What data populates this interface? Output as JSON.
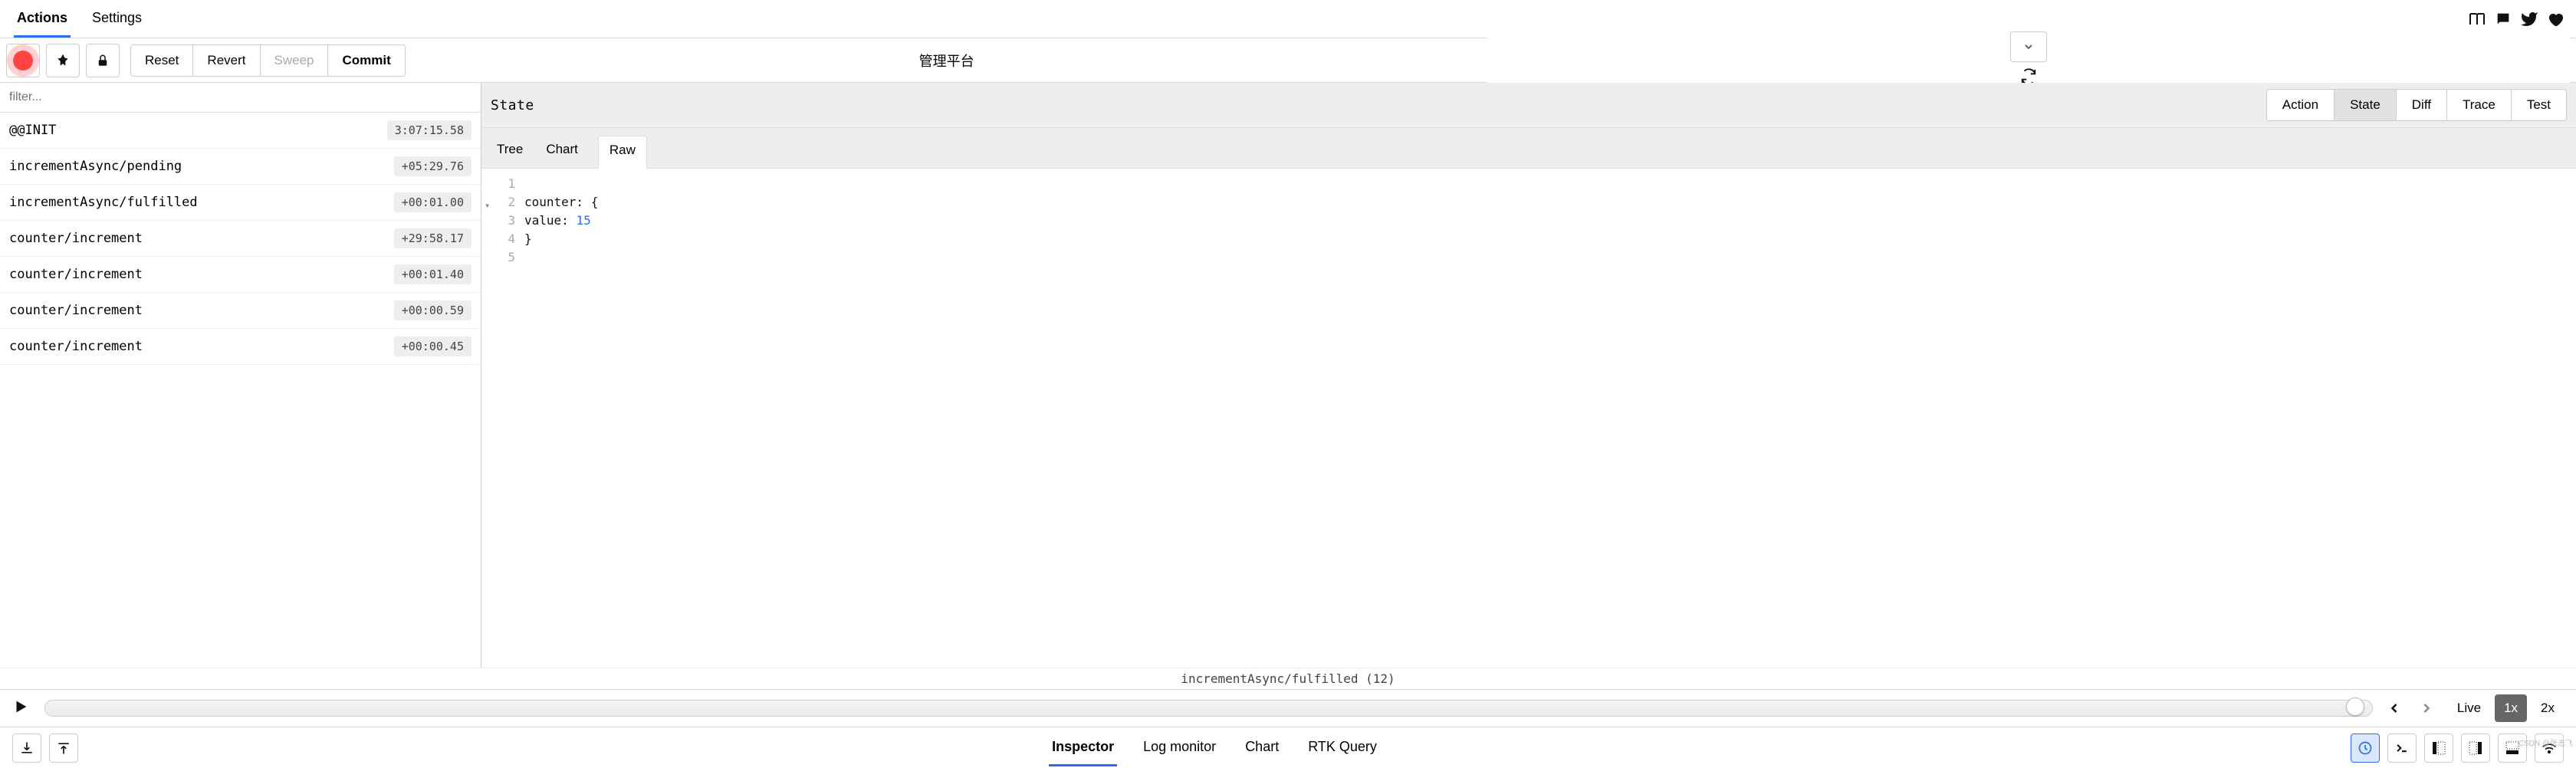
{
  "topbar": {
    "tabs": [
      "Actions",
      "Settings"
    ],
    "active": 0
  },
  "toolbar": {
    "buttons": {
      "reset": "Reset",
      "revert": "Revert",
      "sweep": "Sweep",
      "commit": "Commit"
    },
    "title": "管理平台"
  },
  "filter": {
    "placeholder": "filter..."
  },
  "actions": [
    {
      "name": "@@INIT",
      "time": "3:07:15.58"
    },
    {
      "name": "incrementAsync/pending",
      "time": "+05:29.76"
    },
    {
      "name": "incrementAsync/fulfilled",
      "time": "+00:01.00"
    },
    {
      "name": "counter/increment",
      "time": "+29:58.17"
    },
    {
      "name": "counter/increment",
      "time": "+00:01.40"
    },
    {
      "name": "counter/increment",
      "time": "+00:00.59"
    },
    {
      "name": "counter/increment",
      "time": "+00:00.45"
    }
  ],
  "detail": {
    "heading": "State",
    "segments": [
      "Action",
      "State",
      "Diff",
      "Trace",
      "Test"
    ],
    "segment_active": 1,
    "subtabs": [
      "Tree",
      "Chart",
      "Raw"
    ],
    "subtab_active": 2,
    "lines": [
      {
        "n": "1",
        "t": ""
      },
      {
        "n": "2",
        "t": "counter: {",
        "fold": true
      },
      {
        "n": "3",
        "t": "value: ",
        "num": "15"
      },
      {
        "n": "4",
        "t": "}"
      },
      {
        "n": "5",
        "t": ""
      }
    ]
  },
  "caption": {
    "action": "incrementAsync/fulfilled",
    "count": "(12)"
  },
  "player": {
    "live": "Live",
    "speeds": [
      "1x",
      "2x"
    ],
    "speed_active": 0
  },
  "footer": {
    "tabs": [
      "Inspector",
      "Log monitor",
      "Chart",
      "RTK Query"
    ],
    "active": 0
  },
  "watermark": "CSDN @张志飞"
}
